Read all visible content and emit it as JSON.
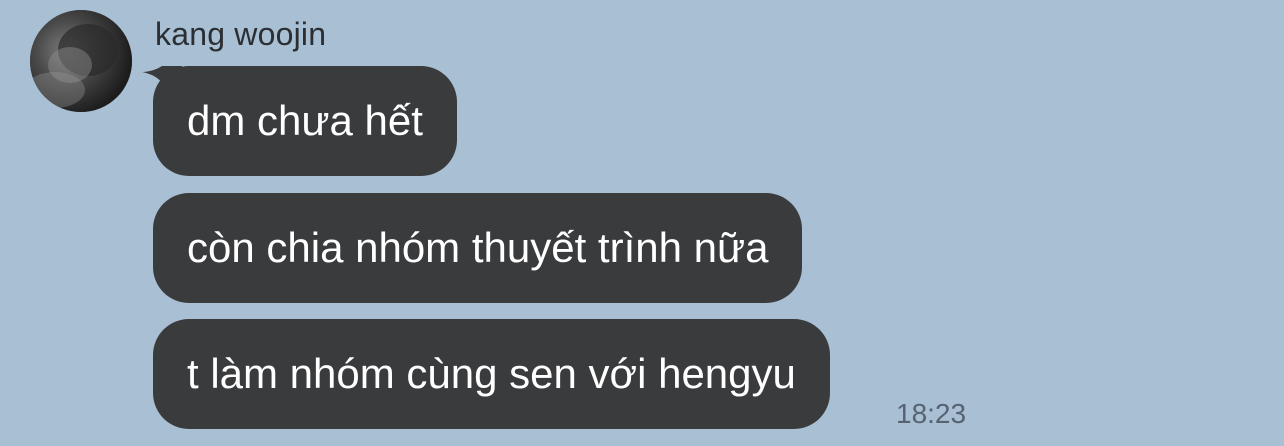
{
  "sender": {
    "name": "kang woojin",
    "avatar_icon": "profile-photo"
  },
  "messages": [
    {
      "text": "dm chưa hết"
    },
    {
      "text": "còn chia nhóm thuyết trình nữa"
    },
    {
      "text": "t làm nhóm cùng sen với hengyu"
    }
  ],
  "timestamp": "18:23",
  "colors": {
    "background": "#a9bfd3",
    "bubble": "#3a3b3d",
    "bubble_text": "#ffffff",
    "name_text": "#2b2f33",
    "timestamp_text": "#556372"
  }
}
